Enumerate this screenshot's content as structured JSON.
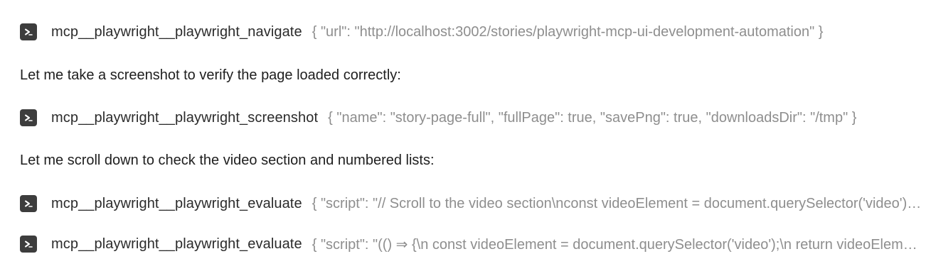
{
  "entries": [
    {
      "type": "tool",
      "icon": "terminal-icon",
      "name": "mcp__playwright__playwright_navigate",
      "args": "{ \"url\": \"http://localhost:3002/stories/playwright-mcp-ui-development-automation\" }"
    },
    {
      "type": "message",
      "text": "Let me take a screenshot to verify the page loaded correctly:"
    },
    {
      "type": "tool",
      "icon": "terminal-icon",
      "name": "mcp__playwright__playwright_screenshot",
      "args": "{ \"name\": \"story-page-full\", \"fullPage\": true, \"savePng\": true, \"downloadsDir\": \"/tmp\" }"
    },
    {
      "type": "message",
      "text": "Let me scroll down to check the video section and numbered lists:"
    },
    {
      "type": "tool",
      "icon": "terminal-icon",
      "name": "mcp__playwright__playwright_evaluate",
      "args": "{ \"script\": \"// Scroll to the video section\\nconst videoElement = document.querySelector('video');\" }"
    },
    {
      "type": "tool",
      "icon": "terminal-icon",
      "name": "mcp__playwright__playwright_evaluate",
      "args": "{ \"script\": \"(() ⇒ {\\n const videoElement = document.querySelector('video');\\n return videoElement; })()\" }"
    }
  ]
}
